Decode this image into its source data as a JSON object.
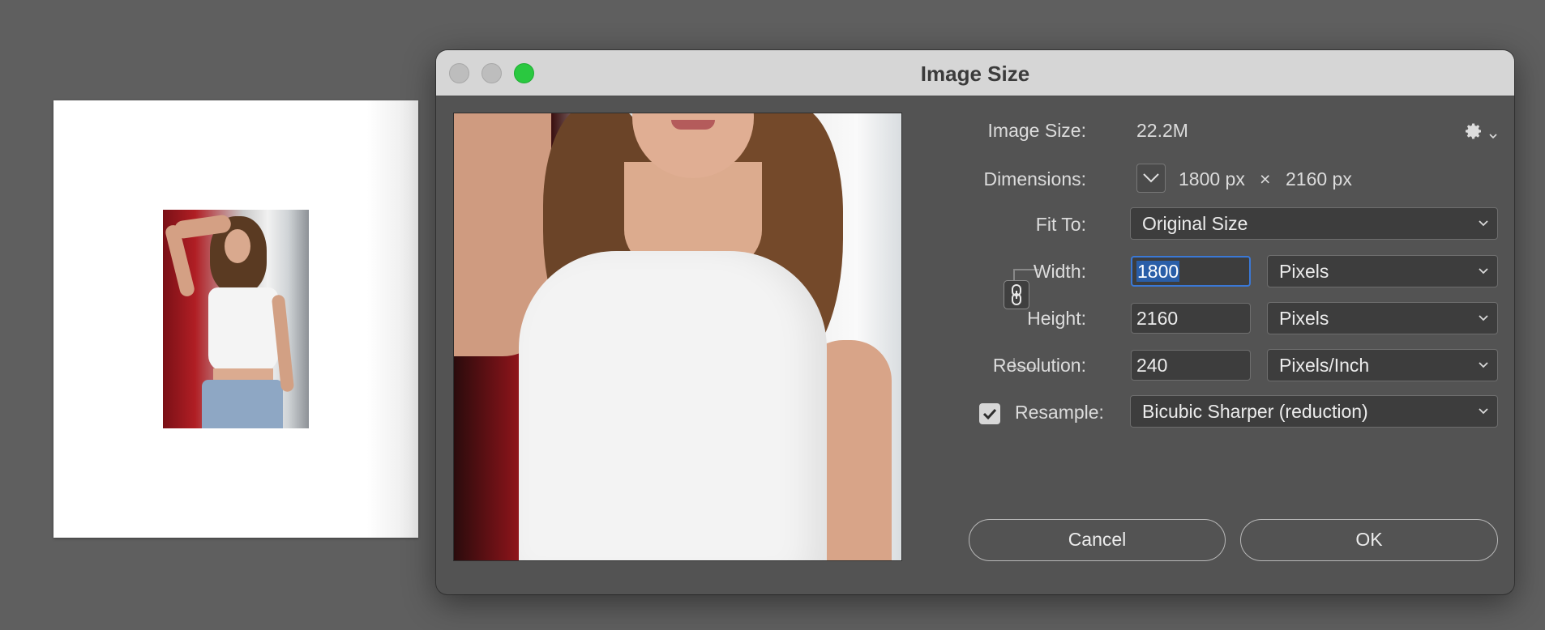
{
  "dialog": {
    "title": "Image Size",
    "image_size_label": "Image Size:",
    "image_size_value": "22.2M",
    "dimensions_label": "Dimensions:",
    "dimensions_width": "1800 px",
    "dimensions_sep": "×",
    "dimensions_height": "2160 px",
    "fit_to_label": "Fit To:",
    "fit_to_value": "Original Size",
    "width_label": "Width:",
    "width_value": "1800",
    "width_unit": "Pixels",
    "height_label": "Height:",
    "height_value": "2160",
    "height_unit": "Pixels",
    "resolution_label": "Resolution:",
    "resolution_value": "240",
    "resolution_unit": "Pixels/Inch",
    "resample_label": "Resample:",
    "resample_checked": true,
    "resample_value": "Bicubic Sharper (reduction)",
    "cancel_label": "Cancel",
    "ok_label": "OK"
  },
  "icons": {
    "settings": "gear-icon",
    "dimensions_toggle": "chevron-down-icon",
    "constrain": "link-icon",
    "checkbox": "checkmark-icon"
  },
  "colors": {
    "background": "#5f5f5f",
    "dialog": "#535353",
    "titlebar": "#d6d6d6",
    "zoom_button": "#2ac840",
    "focus_ring": "#3a78d6",
    "selection": "#2a5ea8"
  }
}
